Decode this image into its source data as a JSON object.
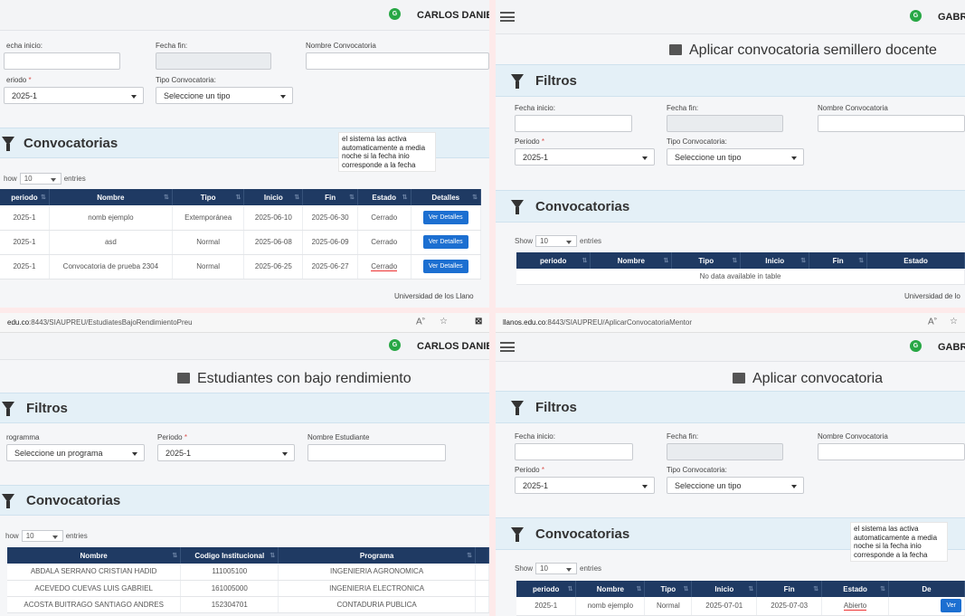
{
  "q1": {
    "user": "CARLOS DANIE",
    "labels": {
      "fecha_inicio": "echa inicio:",
      "fecha_fin": "Fecha fin:",
      "nombre": "Nombre Convocatoria",
      "periodo": "eriodo",
      "tipo": "Tipo Convocatoria:"
    },
    "periodo_value": "2025-1",
    "tipo_value": "Seleccione un tipo",
    "section": "Convocatorias",
    "note": "el sistema las activa automaticamente a media noche si la fecha inio corresponde a la fecha",
    "show": "how",
    "show_value": "10",
    "entries": "entries",
    "headers": [
      "periodo",
      "Nombre",
      "Tipo",
      "Inicio",
      "Fin",
      "Estado",
      "Detalles"
    ],
    "rows": [
      [
        "2025-1",
        "nomb ejemplo",
        "Extemporánea",
        "2025-06-10",
        "2025-06-30",
        "Cerrado"
      ],
      [
        "2025-1",
        "asd",
        "Normal",
        "2025-06-08",
        "2025-06-09",
        "Cerrado"
      ],
      [
        "2025-1",
        "Convocatoria de prueba 2304",
        "Normal",
        "2025-06-25",
        "2025-06-27",
        "Cerrado"
      ]
    ],
    "detail_btn": "Ver Detalles",
    "footer": "Universidad de los Llano"
  },
  "q2": {
    "user": "GABRI",
    "title": "Aplicar convocatoria semillero docente",
    "filters": "Filtros",
    "labels": {
      "fecha_inicio": "Fecha inicio:",
      "fecha_fin": "Fecha fin:",
      "nombre": "Nombre Convocatoria",
      "periodo": "Periodo",
      "tipo": "Tipo Convocatoria:"
    },
    "periodo_value": "2025-1",
    "tipo_value": "Seleccione un tipo",
    "section": "Convocatorias",
    "show": "Show",
    "show_value": "10",
    "entries": "entries",
    "headers": [
      "periodo",
      "Nombre",
      "Tipo",
      "Inicio",
      "Fin",
      "Estado"
    ],
    "empty": "No data available in table",
    "footer": "Universidad de lo"
  },
  "q3": {
    "url_domain": "edu.co",
    "url_path": ":8443/SIAUPREU/EstudiatesBajoRendimientoPreu",
    "user": "CARLOS DANIE",
    "title": "Estudiantes con bajo rendimiento",
    "filters": "Filtros",
    "labels": {
      "programa": "rogramma",
      "periodo": "Periodo",
      "nombre": "Nombre Estudiante"
    },
    "programa_value": "Seleccione un programa",
    "periodo_value": "2025-1",
    "section": "Convocatorias",
    "show": "how",
    "show_value": "10",
    "entries": "entries",
    "headers": [
      "Nombre",
      "Codigo Institucional",
      "Programa"
    ],
    "rows": [
      [
        "ABDALA SERRANO CRISTIAN HADID",
        "111005100",
        "INGENIERIA AGRONOMICA"
      ],
      [
        "ACEVEDO CUEVAS LUIS GABRIEL",
        "161005000",
        "INGENIERIA ELECTRONICA"
      ],
      [
        "ACOSTA BUITRAGO SANTIAGO ANDRES",
        "152304701",
        "CONTADURIA PUBLICA"
      ]
    ]
  },
  "q4": {
    "url_domain": "llanos.edu.co",
    "url_path": ":8443/SIAUPREU/AplicarConvocatoriaMentor",
    "user": "GABRI",
    "title": "Aplicar convocatoria",
    "filters": "Filtros",
    "labels": {
      "fecha_inicio": "Fecha inicio:",
      "fecha_fin": "Fecha fin:",
      "nombre": "Nombre Convocatoria",
      "periodo": "Periodo",
      "tipo": "Tipo Convocatoria:"
    },
    "periodo_value": "2025-1",
    "tipo_value": "Seleccione un tipo",
    "section": "Convocatorias",
    "note": "el sistema las activa automaticamente a media noche si la fecha inio corresponde a la fecha",
    "show": "Show",
    "show_value": "10",
    "entries": "entries",
    "headers": [
      "periodo",
      "Nombre",
      "Tipo",
      "Inicio",
      "Fin",
      "Estado",
      "De"
    ],
    "rows": [
      [
        "2025-1",
        "nomb ejemplo",
        "Normal",
        "2025-07-01",
        "2025-07-03",
        "Abierto"
      ]
    ],
    "detail_btn": "Ver"
  },
  "colors": {
    "header": "#1f3a63",
    "band": "#e4f0f7",
    "button": "#1c6fd1",
    "badge": "#28a745"
  }
}
